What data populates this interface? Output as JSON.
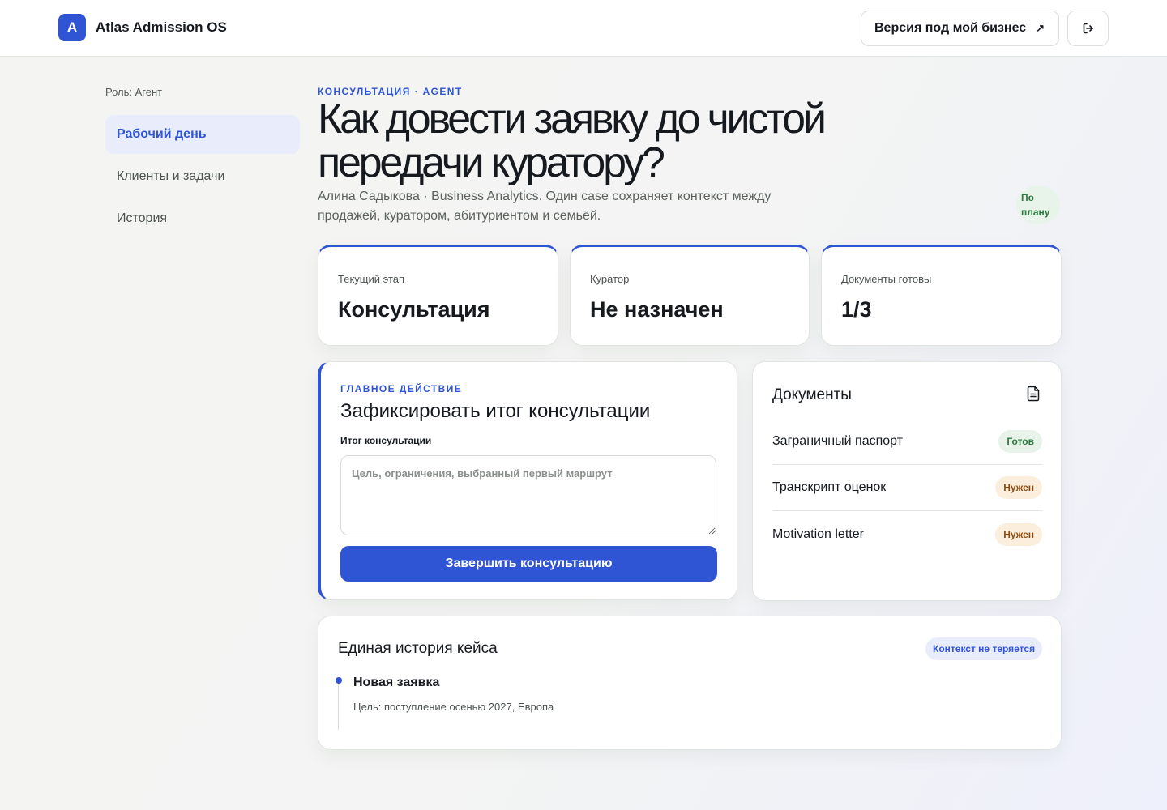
{
  "header": {
    "logo_letter": "A",
    "app_name": "Atlas Admission OS",
    "business_button": "Версия под мой бизнес",
    "business_icon": "arrow-up-right-icon",
    "logout_icon": "logout-icon"
  },
  "sidebar": {
    "role": "Роль: Агент",
    "items": [
      {
        "label": "Рабочий день",
        "active": true
      },
      {
        "label": "Клиенты и задачи",
        "active": false
      },
      {
        "label": "История",
        "active": false
      }
    ]
  },
  "hero": {
    "eyebrow": "КОНСУЛЬТАЦИЯ · AGENT",
    "title": "Как довести заявку до чистой передачи куратору?",
    "subtitle": "Алина Садыкова · Business Analytics. Один case сохраняет контекст между продажей, куратором, абитуриентом и семьёй.",
    "status_badge": "По плану"
  },
  "stats": [
    {
      "label": "Текущий этап",
      "value": "Консультация"
    },
    {
      "label": "Куратор",
      "value": "Не назначен"
    },
    {
      "label": "Документы готовы",
      "value": "1/3"
    }
  ],
  "action": {
    "eyebrow": "ГЛАВНОЕ ДЕЙСТВИЕ",
    "title": "Зафиксировать итог консультации",
    "field_label": "Итог консультации",
    "field_value": "",
    "field_placeholder": "Цель, ограничения, выбранный первый маршрут",
    "button": "Завершить консультацию"
  },
  "documents": {
    "title": "Документы",
    "icon": "document-icon",
    "items": [
      {
        "name": "Заграничный паспорт",
        "status": "Готов",
        "state": "ready"
      },
      {
        "name": "Транскрипт оценок",
        "status": "Нужен",
        "state": "need"
      },
      {
        "name": "Motivation letter",
        "status": "Нужен",
        "state": "need"
      }
    ]
  },
  "history": {
    "title": "Единая история кейса",
    "badge": "Контекст не теряется",
    "events": [
      {
        "title": "Новая заявка",
        "description": "Цель: поступление осенью 2027, Европа"
      }
    ]
  },
  "colors": {
    "accent": "#2f55d4",
    "ready_bg": "#e7f3e9",
    "ready_text": "#2a7a3f",
    "need_bg": "#fbeedd",
    "need_text": "#8c4a0d"
  }
}
